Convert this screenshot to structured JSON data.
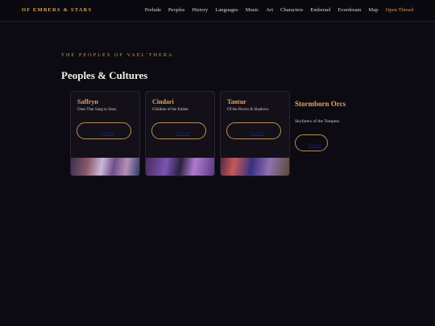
{
  "nav": {
    "brand": "OF EMBERS & STARS",
    "links": [
      "Prelude",
      "Peoples",
      "History",
      "Languages",
      "Music",
      "Art",
      "Characters",
      "Emberael",
      "Everdream",
      "Map"
    ],
    "cta": "Open Thread"
  },
  "section": {
    "eyebrow": "THE PEOPLES OF VAEL'THERA",
    "title": "Peoples & Cultures"
  },
  "cards": [
    {
      "name": "Saffryn",
      "subtitle": "Ones That Sang to Stars.",
      "button": "Explore"
    },
    {
      "name": "Cindari",
      "subtitle": "Children of the Ember.",
      "button": "Explore"
    },
    {
      "name": "Tantur",
      "subtitle": "Of the Rivers & Shadows",
      "button": "Explore"
    }
  ],
  "featured": {
    "name": "Stormborn Orcs",
    "subtitle": "Skyfarers of the Tempest.",
    "button": "Explore"
  },
  "colors": {
    "background": "#0c0a12",
    "accent": "#e3a75a",
    "cta": "#d99a3f",
    "link": "#1c19a8"
  }
}
